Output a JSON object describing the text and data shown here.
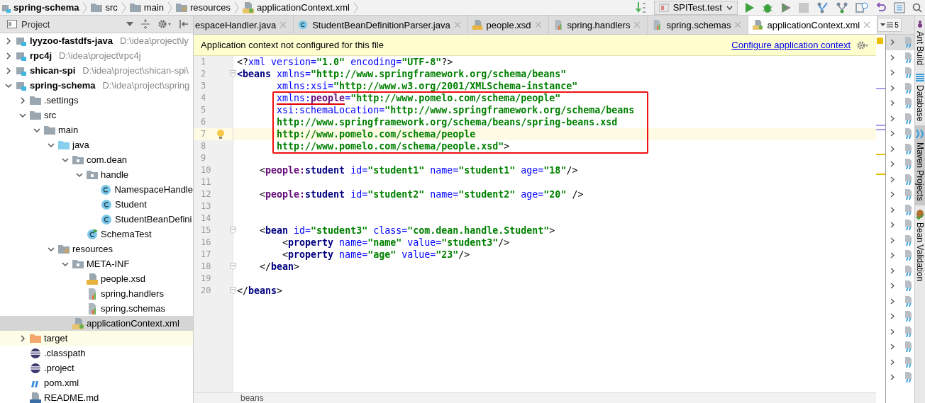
{
  "breadcrumb": [
    {
      "label": "spring-schema",
      "kind": "module"
    },
    {
      "label": "src",
      "kind": "folder"
    },
    {
      "label": "main",
      "kind": "folder"
    },
    {
      "label": "resources",
      "kind": "resources"
    },
    {
      "label": "applicationContext.xml",
      "kind": "xml"
    }
  ],
  "run_config": {
    "label": "SPITest.test"
  },
  "project_panel": {
    "title": "Project"
  },
  "tree": [
    {
      "label": "lyyzoo-fastdfs-java",
      "path": "D:\\idea\\project\\ly",
      "kind": "module",
      "expanded": false,
      "selected": false
    },
    {
      "label": "rpc4j",
      "path": "D:\\idea\\project\\rpc4j",
      "kind": "module",
      "expanded": false,
      "selected": false
    },
    {
      "label": "shican-spi",
      "path": "D:\\idea\\project\\shican-spi\\",
      "kind": "module",
      "expanded": false,
      "selected": false
    },
    {
      "label": "spring-schema",
      "path": "D:\\idea\\project\\spring",
      "kind": "module",
      "expanded": true,
      "selected": false,
      "children": [
        {
          "label": ".settings",
          "kind": "folder",
          "expanded": false,
          "selected": false
        },
        {
          "label": "src",
          "kind": "folder",
          "expanded": true,
          "selected": false,
          "children": [
            {
              "label": "main",
              "kind": "folder",
              "expanded": true,
              "selected": false,
              "children": [
                {
                  "label": "java",
                  "kind": "source",
                  "expanded": true,
                  "selected": false,
                  "children": [
                    {
                      "label": "com.dean",
                      "kind": "package",
                      "expanded": true,
                      "selected": false,
                      "children": [
                        {
                          "label": "handle",
                          "kind": "package",
                          "expanded": true,
                          "selected": false,
                          "children": [
                            {
                              "label": "NamespaceHandle",
                              "kind": "class",
                              "selected": false
                            },
                            {
                              "label": "Student",
                              "kind": "class",
                              "selected": false
                            },
                            {
                              "label": "StudentBeanDefini",
                              "kind": "class",
                              "selected": false
                            }
                          ]
                        },
                        {
                          "label": "SchemaTest",
                          "kind": "test",
                          "selected": false
                        }
                      ]
                    }
                  ]
                },
                {
                  "label": "resources",
                  "kind": "resources",
                  "expanded": true,
                  "selected": false,
                  "children": [
                    {
                      "label": "META-INF",
                      "kind": "package",
                      "expanded": true,
                      "selected": false,
                      "children": [
                        {
                          "label": "people.xsd",
                          "kind": "xsd",
                          "selected": false
                        },
                        {
                          "label": "spring.handlers",
                          "kind": "props",
                          "selected": false
                        },
                        {
                          "label": "spring.schemas",
                          "kind": "props",
                          "selected": false
                        }
                      ]
                    },
                    {
                      "label": "applicationContext.xml",
                      "kind": "xml",
                      "selected": true
                    }
                  ]
                }
              ]
            }
          ]
        },
        {
          "label": "target",
          "kind": "excluded",
          "expanded": false,
          "selected": false
        },
        {
          "label": ".classpath",
          "kind": "eclipse",
          "selected": false
        },
        {
          "label": ".project",
          "kind": "eclipse",
          "selected": false
        },
        {
          "label": "pom.xml",
          "kind": "maven",
          "selected": false
        },
        {
          "label": "README.md",
          "kind": "md",
          "selected": false
        }
      ]
    }
  ],
  "tabs": [
    {
      "label": "espaceHandler.java",
      "kind": "none",
      "selected": false
    },
    {
      "label": "StudentBeanDefinitionParser.java",
      "kind": "class",
      "selected": false
    },
    {
      "label": "people.xsd",
      "kind": "xsd",
      "selected": false
    },
    {
      "label": "spring.handlers",
      "kind": "props",
      "selected": false
    },
    {
      "label": "spring.schemas",
      "kind": "props",
      "selected": false
    },
    {
      "label": "applicationContext.xml",
      "kind": "xml",
      "selected": true
    }
  ],
  "tab_overflow_count": "5",
  "banner": {
    "message": "Application context not configured for this file",
    "link": "Configure application context"
  },
  "code_blocks": [
    {
      "kind": "plain",
      "lines": [
        {
          "n": "1",
          "kind": "plain",
          "tokens": [
            {
              "t": "<?",
              "kind": "punct"
            },
            {
              "t": "xml version=",
              "kind": "attr"
            },
            {
              "t": "\"1.0\"",
              "kind": "value"
            },
            {
              "t": " encoding=",
              "kind": "attr"
            },
            {
              "t": "\"UTF-8\"",
              "kind": "value"
            },
            {
              "t": "?>",
              "kind": "punct"
            }
          ]
        },
        {
          "n": "2",
          "kind": "fold",
          "tokens": [
            {
              "t": "<beans",
              "kind": "tag"
            },
            {
              "t": " xmlns=",
              "kind": "attr"
            },
            {
              "t": "\"http://www.springframework.org/schema/beans\"",
              "kind": "value"
            }
          ]
        },
        {
          "n": "3",
          "kind": "plain",
          "tokens": [
            {
              "t": "       xmlns:xsi=",
              "kind": "attr"
            },
            {
              "t": "\"http://www.w3.org/2001/XMLSchema-instance\"",
              "kind": "value"
            }
          ]
        }
      ]
    },
    {
      "kind": "boxed",
      "lines": [
        {
          "n": "4",
          "kind": "plain",
          "tokens": [
            {
              "t": "       xmlns:",
              "kind": "attr_marked"
            },
            {
              "t": "people",
              "kind": "ns_marked"
            },
            {
              "t": "=",
              "kind": "attr"
            },
            {
              "t": "\"http://www.pomelo.com/schema/people\"",
              "kind": "value"
            }
          ]
        },
        {
          "n": "5",
          "kind": "plain",
          "tokens": [
            {
              "t": "       xsi:schemaLocation=",
              "kind": "attr"
            },
            {
              "t": "\"http://www.springframework.org/schema/beans",
              "kind": "value"
            }
          ]
        },
        {
          "n": "6",
          "kind": "plain",
          "tokens": [
            {
              "t": "       http://www.springframework.org/schema/beans/spring-beans.xsd",
              "kind": "value"
            }
          ]
        },
        {
          "n": "7",
          "kind": "caret",
          "tokens": [
            {
              "t": "       http://www.pomelo.com/schema/people",
              "kind": "value"
            }
          ]
        },
        {
          "n": "8",
          "kind": "plain",
          "tokens": [
            {
              "t": "       http://www.pomelo.com/schema/people.xsd\"",
              "kind": "value"
            },
            {
              "t": ">",
              "kind": "punct"
            }
          ]
        }
      ]
    },
    {
      "kind": "plain",
      "lines": [
        {
          "n": "9",
          "kind": "plain"
        },
        {
          "n": "10",
          "kind": "plain",
          "tokens": [
            {
              "t": "    <",
              "kind": "punct"
            },
            {
              "t": "people:",
              "kind": "ns"
            },
            {
              "t": "student",
              "kind": "tag"
            },
            {
              "t": " id=",
              "kind": "attr"
            },
            {
              "t": "\"student1\"",
              "kind": "value"
            },
            {
              "t": " name=",
              "kind": "attr"
            },
            {
              "t": "\"student1\"",
              "kind": "value"
            },
            {
              "t": " age=",
              "kind": "attr"
            },
            {
              "t": "\"18\"",
              "kind": "value"
            },
            {
              "t": "/>",
              "kind": "punct"
            }
          ]
        },
        {
          "n": "11",
          "kind": "plain"
        },
        {
          "n": "12",
          "kind": "plain",
          "tokens": [
            {
              "t": "    <",
              "kind": "punct"
            },
            {
              "t": "people:",
              "kind": "ns"
            },
            {
              "t": "student",
              "kind": "tag"
            },
            {
              "t": " id=",
              "kind": "attr"
            },
            {
              "t": "\"student2\"",
              "kind": "value"
            },
            {
              "t": " name=",
              "kind": "attr"
            },
            {
              "t": "\"student2\"",
              "kind": "value"
            },
            {
              "t": " age=",
              "kind": "attr"
            },
            {
              "t": "\"20\"",
              "kind": "value"
            },
            {
              "t": " />",
              "kind": "punct"
            }
          ]
        },
        {
          "n": "13",
          "kind": "plain"
        },
        {
          "n": "14",
          "kind": "plain"
        },
        {
          "n": "15",
          "kind": "fold",
          "tokens": [
            {
              "t": "    <",
              "kind": "punct"
            },
            {
              "t": "bean",
              "kind": "tag"
            },
            {
              "t": " id=",
              "kind": "attr"
            },
            {
              "t": "\"student3\"",
              "kind": "value"
            },
            {
              "t": " class=",
              "kind": "attr"
            },
            {
              "t": "\"com.dean.handle.Student\"",
              "kind": "value"
            },
            {
              "t": ">",
              "kind": "punct"
            }
          ]
        },
        {
          "n": "16",
          "kind": "plain",
          "tokens": [
            {
              "t": "        <",
              "kind": "punct"
            },
            {
              "t": "property",
              "kind": "tag"
            },
            {
              "t": " name=",
              "kind": "attr"
            },
            {
              "t": "\"name\"",
              "kind": "value"
            },
            {
              "t": " value=",
              "kind": "attr"
            },
            {
              "t": "\"student3\"",
              "kind": "value"
            },
            {
              "t": "/>",
              "kind": "punct"
            }
          ]
        },
        {
          "n": "17",
          "kind": "plain",
          "tokens": [
            {
              "t": "        <",
              "kind": "punct"
            },
            {
              "t": "property",
              "kind": "tag"
            },
            {
              "t": " name=",
              "kind": "attr"
            },
            {
              "t": "\"age\"",
              "kind": "value"
            },
            {
              "t": " value=",
              "kind": "attr"
            },
            {
              "t": "\"23\"",
              "kind": "value"
            },
            {
              "t": "/>",
              "kind": "punct"
            }
          ]
        },
        {
          "n": "18",
          "kind": "fold",
          "tokens": [
            {
              "t": "    </",
              "kind": "punct"
            },
            {
              "t": "bean",
              "kind": "tag"
            },
            {
              "t": ">",
              "kind": "punct"
            }
          ]
        },
        {
          "n": "19",
          "kind": "plain"
        },
        {
          "n": "20",
          "kind": "fold",
          "tokens": [
            {
              "t": "</",
              "kind": "punct"
            },
            {
              "t": "beans",
              "kind": "tag"
            },
            {
              "t": ">",
              "kind": "punct"
            }
          ]
        }
      ]
    }
  ],
  "editor_breadcrumb": "beans",
  "tool_windows": [
    {
      "label": "Ant Build",
      "kind": "ant",
      "selected": false
    },
    {
      "label": "Database",
      "kind": "db",
      "selected": false
    },
    {
      "label": "Maven Projects",
      "kind": "maven",
      "selected": true
    },
    {
      "label": "Bean Validation",
      "kind": "bean",
      "selected": false
    }
  ]
}
